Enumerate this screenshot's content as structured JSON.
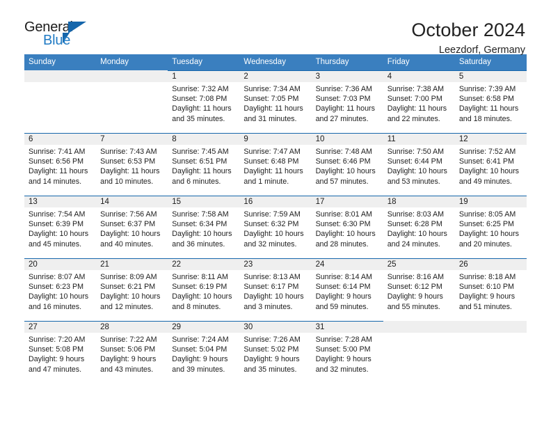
{
  "brand": {
    "word_one": "General",
    "word_two": "Blue",
    "accent_color": "#1566ab",
    "link_color": "#1f7ac4"
  },
  "header": {
    "title": "October 2024",
    "subtitle": "Leezdorf, Germany"
  },
  "theme": {
    "header_row_bg": "#3a7fbf",
    "daynum_band_bg": "#efefef",
    "day_top_border": "#1566ab"
  },
  "calendar": {
    "weekday_headers": [
      "Sunday",
      "Monday",
      "Tuesday",
      "Wednesday",
      "Thursday",
      "Friday",
      "Saturday"
    ],
    "weeks": [
      [
        {
          "day": "",
          "sunrise": "",
          "sunset": "",
          "daylight_line1": "",
          "daylight_line2": ""
        },
        {
          "day": "",
          "sunrise": "",
          "sunset": "",
          "daylight_line1": "",
          "daylight_line2": ""
        },
        {
          "day": "1",
          "sunrise": "Sunrise: 7:32 AM",
          "sunset": "Sunset: 7:08 PM",
          "daylight_line1": "Daylight: 11 hours",
          "daylight_line2": "and 35 minutes."
        },
        {
          "day": "2",
          "sunrise": "Sunrise: 7:34 AM",
          "sunset": "Sunset: 7:05 PM",
          "daylight_line1": "Daylight: 11 hours",
          "daylight_line2": "and 31 minutes."
        },
        {
          "day": "3",
          "sunrise": "Sunrise: 7:36 AM",
          "sunset": "Sunset: 7:03 PM",
          "daylight_line1": "Daylight: 11 hours",
          "daylight_line2": "and 27 minutes."
        },
        {
          "day": "4",
          "sunrise": "Sunrise: 7:38 AM",
          "sunset": "Sunset: 7:00 PM",
          "daylight_line1": "Daylight: 11 hours",
          "daylight_line2": "and 22 minutes."
        },
        {
          "day": "5",
          "sunrise": "Sunrise: 7:39 AM",
          "sunset": "Sunset: 6:58 PM",
          "daylight_line1": "Daylight: 11 hours",
          "daylight_line2": "and 18 minutes."
        }
      ],
      [
        {
          "day": "6",
          "sunrise": "Sunrise: 7:41 AM",
          "sunset": "Sunset: 6:56 PM",
          "daylight_line1": "Daylight: 11 hours",
          "daylight_line2": "and 14 minutes."
        },
        {
          "day": "7",
          "sunrise": "Sunrise: 7:43 AM",
          "sunset": "Sunset: 6:53 PM",
          "daylight_line1": "Daylight: 11 hours",
          "daylight_line2": "and 10 minutes."
        },
        {
          "day": "8",
          "sunrise": "Sunrise: 7:45 AM",
          "sunset": "Sunset: 6:51 PM",
          "daylight_line1": "Daylight: 11 hours",
          "daylight_line2": "and 6 minutes."
        },
        {
          "day": "9",
          "sunrise": "Sunrise: 7:47 AM",
          "sunset": "Sunset: 6:48 PM",
          "daylight_line1": "Daylight: 11 hours",
          "daylight_line2": "and 1 minute."
        },
        {
          "day": "10",
          "sunrise": "Sunrise: 7:48 AM",
          "sunset": "Sunset: 6:46 PM",
          "daylight_line1": "Daylight: 10 hours",
          "daylight_line2": "and 57 minutes."
        },
        {
          "day": "11",
          "sunrise": "Sunrise: 7:50 AM",
          "sunset": "Sunset: 6:44 PM",
          "daylight_line1": "Daylight: 10 hours",
          "daylight_line2": "and 53 minutes."
        },
        {
          "day": "12",
          "sunrise": "Sunrise: 7:52 AM",
          "sunset": "Sunset: 6:41 PM",
          "daylight_line1": "Daylight: 10 hours",
          "daylight_line2": "and 49 minutes."
        }
      ],
      [
        {
          "day": "13",
          "sunrise": "Sunrise: 7:54 AM",
          "sunset": "Sunset: 6:39 PM",
          "daylight_line1": "Daylight: 10 hours",
          "daylight_line2": "and 45 minutes."
        },
        {
          "day": "14",
          "sunrise": "Sunrise: 7:56 AM",
          "sunset": "Sunset: 6:37 PM",
          "daylight_line1": "Daylight: 10 hours",
          "daylight_line2": "and 40 minutes."
        },
        {
          "day": "15",
          "sunrise": "Sunrise: 7:58 AM",
          "sunset": "Sunset: 6:34 PM",
          "daylight_line1": "Daylight: 10 hours",
          "daylight_line2": "and 36 minutes."
        },
        {
          "day": "16",
          "sunrise": "Sunrise: 7:59 AM",
          "sunset": "Sunset: 6:32 PM",
          "daylight_line1": "Daylight: 10 hours",
          "daylight_line2": "and 32 minutes."
        },
        {
          "day": "17",
          "sunrise": "Sunrise: 8:01 AM",
          "sunset": "Sunset: 6:30 PM",
          "daylight_line1": "Daylight: 10 hours",
          "daylight_line2": "and 28 minutes."
        },
        {
          "day": "18",
          "sunrise": "Sunrise: 8:03 AM",
          "sunset": "Sunset: 6:28 PM",
          "daylight_line1": "Daylight: 10 hours",
          "daylight_line2": "and 24 minutes."
        },
        {
          "day": "19",
          "sunrise": "Sunrise: 8:05 AM",
          "sunset": "Sunset: 6:25 PM",
          "daylight_line1": "Daylight: 10 hours",
          "daylight_line2": "and 20 minutes."
        }
      ],
      [
        {
          "day": "20",
          "sunrise": "Sunrise: 8:07 AM",
          "sunset": "Sunset: 6:23 PM",
          "daylight_line1": "Daylight: 10 hours",
          "daylight_line2": "and 16 minutes."
        },
        {
          "day": "21",
          "sunrise": "Sunrise: 8:09 AM",
          "sunset": "Sunset: 6:21 PM",
          "daylight_line1": "Daylight: 10 hours",
          "daylight_line2": "and 12 minutes."
        },
        {
          "day": "22",
          "sunrise": "Sunrise: 8:11 AM",
          "sunset": "Sunset: 6:19 PM",
          "daylight_line1": "Daylight: 10 hours",
          "daylight_line2": "and 8 minutes."
        },
        {
          "day": "23",
          "sunrise": "Sunrise: 8:13 AM",
          "sunset": "Sunset: 6:17 PM",
          "daylight_line1": "Daylight: 10 hours",
          "daylight_line2": "and 3 minutes."
        },
        {
          "day": "24",
          "sunrise": "Sunrise: 8:14 AM",
          "sunset": "Sunset: 6:14 PM",
          "daylight_line1": "Daylight: 9 hours",
          "daylight_line2": "and 59 minutes."
        },
        {
          "day": "25",
          "sunrise": "Sunrise: 8:16 AM",
          "sunset": "Sunset: 6:12 PM",
          "daylight_line1": "Daylight: 9 hours",
          "daylight_line2": "and 55 minutes."
        },
        {
          "day": "26",
          "sunrise": "Sunrise: 8:18 AM",
          "sunset": "Sunset: 6:10 PM",
          "daylight_line1": "Daylight: 9 hours",
          "daylight_line2": "and 51 minutes."
        }
      ],
      [
        {
          "day": "27",
          "sunrise": "Sunrise: 7:20 AM",
          "sunset": "Sunset: 5:08 PM",
          "daylight_line1": "Daylight: 9 hours",
          "daylight_line2": "and 47 minutes."
        },
        {
          "day": "28",
          "sunrise": "Sunrise: 7:22 AM",
          "sunset": "Sunset: 5:06 PM",
          "daylight_line1": "Daylight: 9 hours",
          "daylight_line2": "and 43 minutes."
        },
        {
          "day": "29",
          "sunrise": "Sunrise: 7:24 AM",
          "sunset": "Sunset: 5:04 PM",
          "daylight_line1": "Daylight: 9 hours",
          "daylight_line2": "and 39 minutes."
        },
        {
          "day": "30",
          "sunrise": "Sunrise: 7:26 AM",
          "sunset": "Sunset: 5:02 PM",
          "daylight_line1": "Daylight: 9 hours",
          "daylight_line2": "and 35 minutes."
        },
        {
          "day": "31",
          "sunrise": "Sunrise: 7:28 AM",
          "sunset": "Sunset: 5:00 PM",
          "daylight_line1": "Daylight: 9 hours",
          "daylight_line2": "and 32 minutes."
        },
        {
          "day": "",
          "sunrise": "",
          "sunset": "",
          "daylight_line1": "",
          "daylight_line2": ""
        },
        {
          "day": "",
          "sunrise": "",
          "sunset": "",
          "daylight_line1": "",
          "daylight_line2": ""
        }
      ]
    ]
  }
}
